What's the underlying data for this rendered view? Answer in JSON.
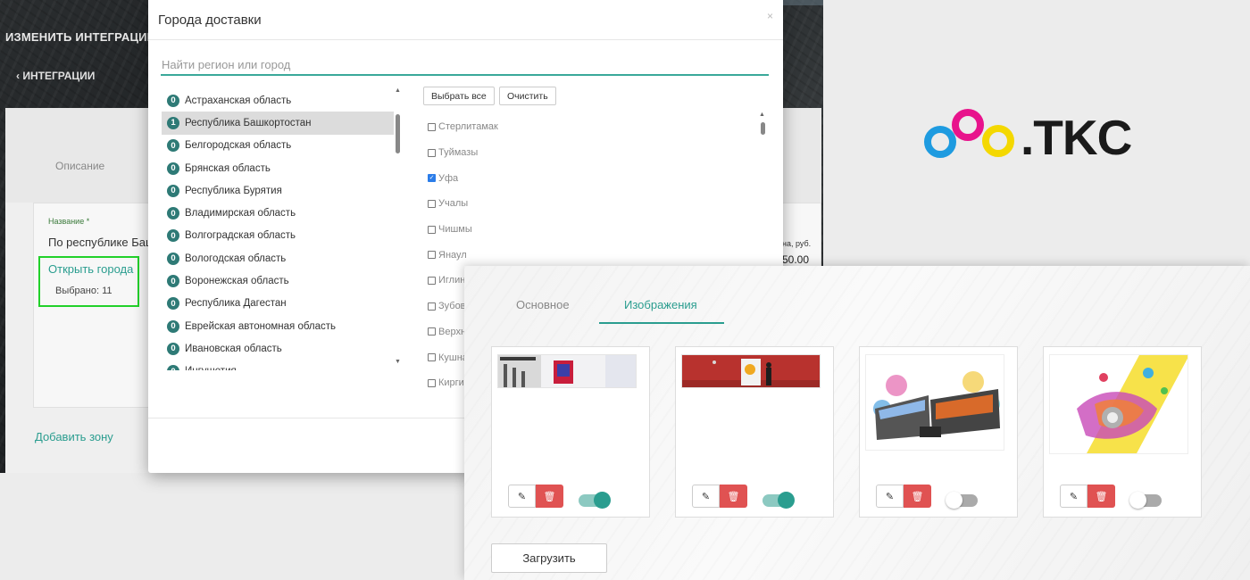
{
  "background_app": {
    "title": "ИЗМЕНИТЬ ИНТЕГРАЦИЮ",
    "back_link": "‹ ИНТЕГРАЦИИ",
    "tab_description": "Описание",
    "name_label": "Название *",
    "name_value": "По республике Баш",
    "open_cities": "Открыть города",
    "selected_count": "Выбрано: 11",
    "add_zone": "Добавить зону",
    "price_label": "на, руб.",
    "price_value": "50.00"
  },
  "modal": {
    "title": "Города доставки",
    "close_icon": "×",
    "search_placeholder": "Найти регион или город",
    "select_all": "Выбрать все",
    "clear": "Очистить",
    "regions": [
      {
        "count": "0",
        "name": "Астраханская область",
        "active": false
      },
      {
        "count": "1",
        "name": "Республика Башкортостан",
        "active": true
      },
      {
        "count": "0",
        "name": "Белгородская область",
        "active": false
      },
      {
        "count": "0",
        "name": "Брянская область",
        "active": false
      },
      {
        "count": "0",
        "name": "Республика Бурятия",
        "active": false
      },
      {
        "count": "0",
        "name": "Владимирская область",
        "active": false
      },
      {
        "count": "0",
        "name": "Волгоградская область",
        "active": false
      },
      {
        "count": "0",
        "name": "Вологодская область",
        "active": false
      },
      {
        "count": "0",
        "name": "Воронежская область",
        "active": false
      },
      {
        "count": "0",
        "name": "Республика Дагестан",
        "active": false
      },
      {
        "count": "0",
        "name": "Еврейская автономная область",
        "active": false
      },
      {
        "count": "0",
        "name": "Ивановская область",
        "active": false
      },
      {
        "count": "0",
        "name": "Ингушетия",
        "active": false
      }
    ],
    "cities": [
      {
        "name": "Стерлитамак",
        "checked": false
      },
      {
        "name": "Туймазы",
        "checked": false
      },
      {
        "name": "Уфа",
        "checked": true
      },
      {
        "name": "Учалы",
        "checked": false
      },
      {
        "name": "Чишмы",
        "checked": false
      },
      {
        "name": "Янаул",
        "checked": false
      },
      {
        "name": "Иглино",
        "checked": false
      },
      {
        "name": "Зубово",
        "checked": false
      },
      {
        "name": "Верхнеяркеево",
        "checked": false
      },
      {
        "name": "Кушнаренково",
        "checked": false
      },
      {
        "name": "Киргиз-Мияки",
        "checked": false
      }
    ]
  },
  "logo": {
    "text": ".TKC",
    "colors": [
      "#1e9be0",
      "#e8138c",
      "#f4d800"
    ]
  },
  "images_panel": {
    "tabs": [
      "Основное",
      "Изображения"
    ],
    "active_tab": 1,
    "cards": [
      {
        "image": "gallery-room-photo",
        "enabled": true
      },
      {
        "image": "red-wall-person-photo",
        "enabled": true
      },
      {
        "image": "printers-illustration",
        "enabled": false
      },
      {
        "image": "paint-splash-roll-illustration",
        "enabled": false
      }
    ],
    "upload_label": "Загрузить",
    "accent_color": "#2a9d8f",
    "delete_color": "#e05252"
  }
}
